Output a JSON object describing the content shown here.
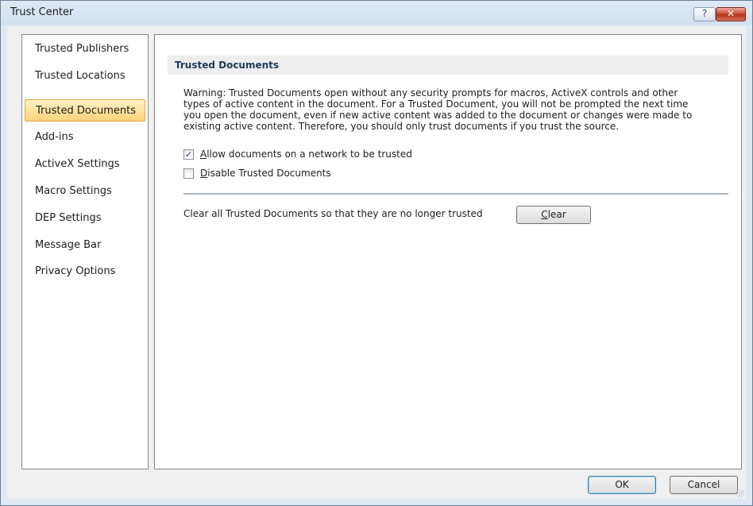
{
  "window": {
    "title": "Trust Center",
    "help_label": "?",
    "close_label": "✕"
  },
  "nav": {
    "items": [
      {
        "label": "Trusted Publishers"
      },
      {
        "label": "Trusted Locations"
      },
      {
        "label": "Trusted Documents"
      },
      {
        "label": "Add-ins"
      },
      {
        "label": "ActiveX Settings"
      },
      {
        "label": "Macro Settings"
      },
      {
        "label": "DEP Settings"
      },
      {
        "label": "Message Bar"
      },
      {
        "label": "Privacy Options"
      }
    ],
    "selected": "Trusted Documents"
  },
  "panel": {
    "header": "Trusted Documents",
    "warning_lines": [
      "Warning: Trusted Documents open without any security prompts for macros, ActiveX controls and other",
      "types of active content in the document.  For a Trusted Document, you will not be prompted the next time",
      "you open the document, even if new active content was added to the document or changes were made to",
      "existing active content. Therefore, you should only trust documents if you trust the source."
    ],
    "allow_network": {
      "label_prefix": "",
      "label_accel": "A",
      "label_rest": "llow documents on a network to be trusted",
      "checked": true
    },
    "disable_trusted": {
      "label_accel": "D",
      "label_rest": "isable Trusted Documents",
      "checked": false
    },
    "clear_text": "Clear all Trusted Documents so that they are no longer trusted",
    "clear_button": {
      "accel": "C",
      "rest": "lear"
    }
  },
  "footer": {
    "ok_label": "OK",
    "cancel_label": "Cancel"
  }
}
